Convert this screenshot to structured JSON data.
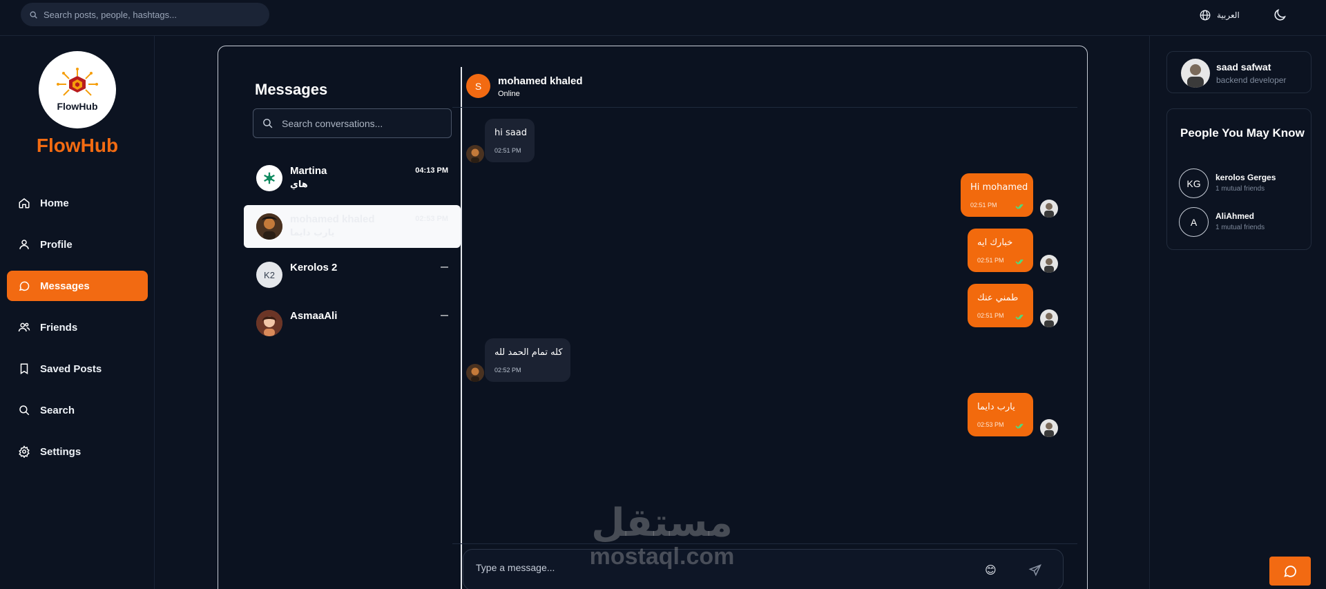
{
  "topbar": {
    "search_placeholder": "Search posts, people, hashtags...",
    "language_label": "العربية"
  },
  "sidebar": {
    "logo_text": "FlowHub",
    "brand": "FlowHub",
    "items": [
      {
        "label": "Home",
        "icon": "home-icon"
      },
      {
        "label": "Profile",
        "icon": "user-icon"
      },
      {
        "label": "Messages",
        "icon": "message-icon",
        "active": true
      },
      {
        "label": "Friends",
        "icon": "friends-icon"
      },
      {
        "label": "Saved Posts",
        "icon": "bookmark-icon"
      },
      {
        "label": "Search",
        "icon": "search-icon"
      },
      {
        "label": "Settings",
        "icon": "gear-icon"
      }
    ]
  },
  "conversations": {
    "title": "Messages",
    "search_placeholder": "Search conversations...",
    "items": [
      {
        "name": "Martina",
        "preview": "هاي",
        "time": "04:13 PM"
      },
      {
        "name": "mohamed khaled",
        "preview": "يارب دايما",
        "time": "02:53 PM",
        "selected": true
      },
      {
        "name": "Kerolos 2",
        "initials": "K2",
        "preview": "",
        "time": "—"
      },
      {
        "name": "AsmaaAli",
        "preview": "",
        "time": "—"
      }
    ]
  },
  "chat": {
    "contact_initial": "S",
    "contact_name": "mohamed khaled",
    "status": "Online",
    "messages": [
      {
        "direction": "in",
        "text": "hi saad",
        "time": "02:51 PM"
      },
      {
        "direction": "out",
        "text": "Hi mohamed",
        "time": "02:51 PM"
      },
      {
        "direction": "out",
        "text": "خبارك ايه",
        "time": "02:51 PM"
      },
      {
        "direction": "out",
        "text": "طمني عنك",
        "time": "02:51 PM"
      },
      {
        "direction": "in",
        "text": "كله تمام الحمد لله",
        "time": "02:52 PM"
      },
      {
        "direction": "out",
        "text": "يارب دايما",
        "time": "02:53 PM"
      }
    ],
    "composer_placeholder": "Type a message...",
    "emoji": "😊"
  },
  "right": {
    "user_name": "saad safwat",
    "user_role": "backend developer",
    "pymk_title": "People You May Know",
    "people": [
      {
        "initials": "KG",
        "name": "kerolos Gerges",
        "mutual": "1 mutual friends"
      },
      {
        "initials": "A",
        "name": "AliAhmed",
        "mutual": "1 mutual friends"
      }
    ]
  },
  "watermark": {
    "arabic": "مستقل",
    "latin": "mostaql.com"
  },
  "colors": {
    "accent": "#f26a12",
    "background": "#0c1321",
    "bubble_in": "#1b2232",
    "read_check": "#4ade80"
  }
}
